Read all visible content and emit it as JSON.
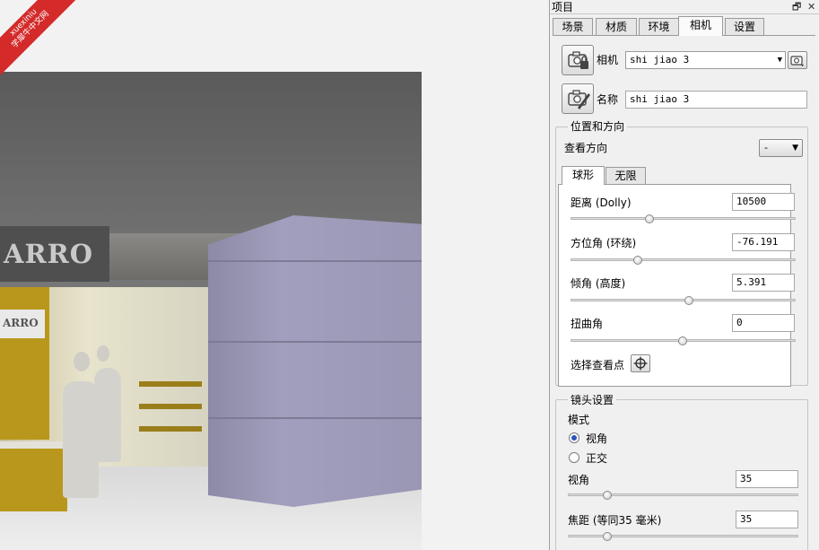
{
  "watermark": {
    "line1": "xuexiniu",
    "line2": "学犀牛中文网"
  },
  "viewport": {
    "sign_large": "ARRO",
    "sign_small": "ARRO"
  },
  "panel": {
    "title": "项目",
    "restore_icon": "restore-icon",
    "close_icon": "close-icon",
    "tabs": [
      {
        "label": "场景",
        "active": false
      },
      {
        "label": "材质",
        "active": false
      },
      {
        "label": "环境",
        "active": false
      },
      {
        "label": "相机",
        "active": true
      },
      {
        "label": "设置",
        "active": false
      }
    ],
    "camera": {
      "label": "相机",
      "selected": "shi jiao 3",
      "name_label": "名称",
      "name_value": "shi jiao 3"
    },
    "position_group": {
      "title": "位置和方向",
      "view_direction_label": "查看方向",
      "view_direction_value": "-",
      "subtabs": [
        {
          "label": "球形",
          "active": true
        },
        {
          "label": "无限",
          "active": false
        }
      ],
      "params": [
        {
          "label": "距离 (Dolly)",
          "value": "10500"
        },
        {
          "label": "方位角 (环绕)",
          "value": "-76.191"
        },
        {
          "label": "倾角 (高度)",
          "value": "5.391"
        },
        {
          "label": "扭曲角",
          "value": "0"
        }
      ],
      "slider_levels": [
        0.36,
        0.3,
        0.53,
        0.5
      ],
      "pick_lookat_label": "选择查看点"
    },
    "lens_group": {
      "title": "镜头设置",
      "mode_label": "模式",
      "modes": [
        {
          "label": "视角",
          "checked": true
        },
        {
          "label": "正交",
          "checked": false
        }
      ],
      "fov_label": "视角",
      "fov_value": "35",
      "focal_label": "焦距 (等同35 毫米)",
      "focal_value": "35",
      "slider_levels": [
        0.17,
        0.17
      ]
    }
  }
}
